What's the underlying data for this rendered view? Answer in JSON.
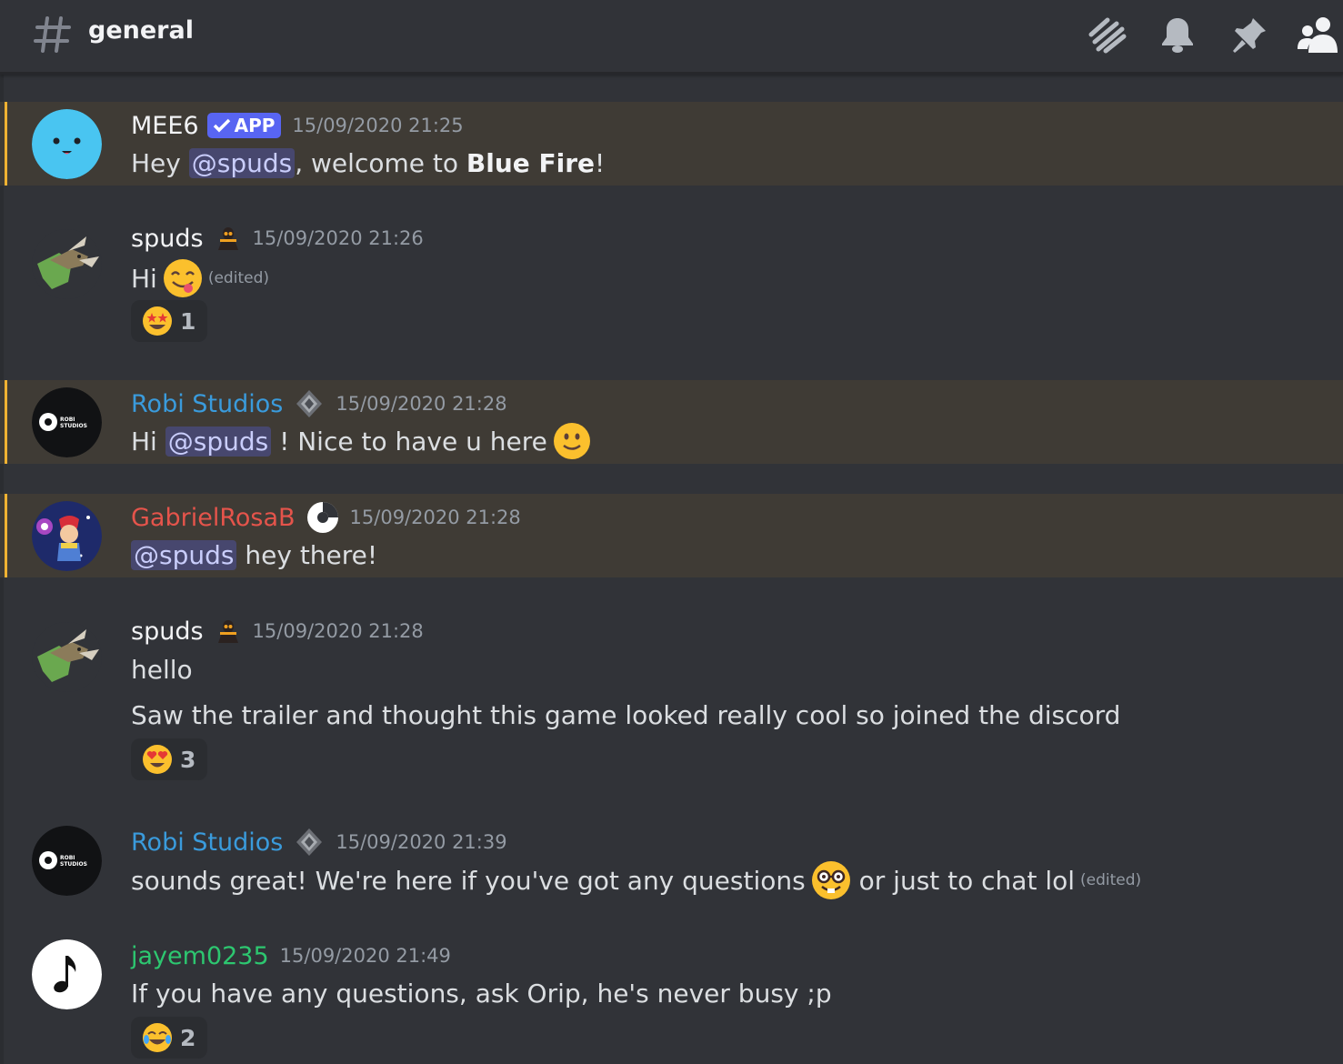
{
  "channel": {
    "name": "general"
  },
  "header_icons": [
    "threads-icon",
    "bell-icon",
    "pin-icon",
    "members-icon"
  ],
  "mention_text": "@spuds",
  "messages": [
    {
      "author": "MEE6",
      "author_color": "#f2f3f5",
      "app_label": "APP",
      "timestamp": "15/09/2020 21:25",
      "text_a": "Hey ",
      "text_b": ", welcome to ",
      "text_bold": "Blue Fire",
      "text_c": "!"
    },
    {
      "author": "spuds",
      "author_color": "#f2f3f5",
      "timestamp": "15/09/2020 21:26",
      "text": "Hi",
      "edited": "(edited)",
      "reaction_count": "1"
    },
    {
      "author": "Robi Studios",
      "author_color": "#3a9bdc",
      "timestamp": "15/09/2020 21:28",
      "text_a": "Hi ",
      "text_b": " ! Nice to have u here"
    },
    {
      "author": "GabrielRosaB",
      "author_color": "#e5544b",
      "timestamp": "15/09/2020 21:28",
      "text_b": " hey there!"
    },
    {
      "author": "spuds",
      "author_color": "#f2f3f5",
      "timestamp": "15/09/2020 21:28",
      "line1": "hello",
      "line2": "Saw the trailer and thought this game looked really cool so joined the discord",
      "reaction_count": "3"
    },
    {
      "author": "Robi Studios",
      "author_color": "#3a9bdc",
      "timestamp": "15/09/2020 21:39",
      "text_a": "sounds great! We're here if you've got any questions",
      "text_b": " or just to chat lol",
      "edited": "(edited)"
    },
    {
      "author": "jayem0235",
      "author_color": "#2dc770",
      "timestamp": "15/09/2020 21:49",
      "text": "If you have any questions, ask Orip, he's never busy ;p",
      "reaction_count": "2"
    }
  ],
  "avatars": {
    "robi_text_1": "ROBI",
    "robi_text_2": "STUDIOS"
  },
  "colors": {
    "background": "#313338",
    "highlight": "#3f3b35",
    "highlight_bar": "#f0b232",
    "mention_bg": "#3c4270",
    "app_badge": "#5865f2"
  }
}
